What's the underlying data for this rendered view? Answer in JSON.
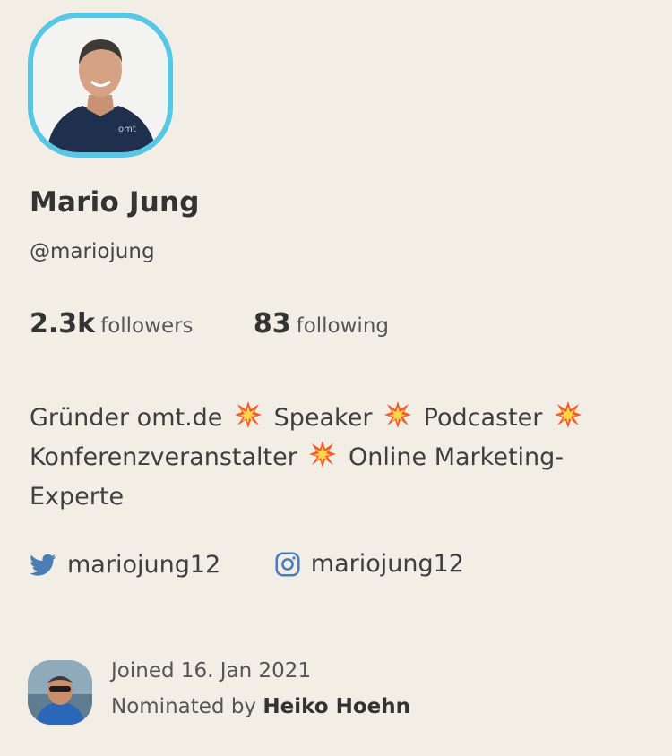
{
  "profile": {
    "name": "Mario Jung",
    "handle": "@mariojung",
    "avatar_border_color": "#56c8e6"
  },
  "stats": {
    "followers_count": "2.3k",
    "followers_label": "followers",
    "following_count": "83",
    "following_label": "following"
  },
  "bio": {
    "parts": [
      "Gründer omt.de",
      "Speaker",
      "Podcaster",
      "Konferenzveranstalter",
      "Online Marketing-Experte"
    ],
    "separator_icon": "collision-emoji"
  },
  "socials": {
    "twitter": {
      "icon": "twitter-icon",
      "username": "mariojung12",
      "color": "#4a7fb5"
    },
    "instagram": {
      "icon": "instagram-icon",
      "username": "mariojung12",
      "color": "#4a7fb5"
    }
  },
  "meta": {
    "joined": "Joined 16. Jan 2021",
    "nominated_prefix": "Nominated by",
    "nominated_by": "Heiko Hoehn"
  }
}
